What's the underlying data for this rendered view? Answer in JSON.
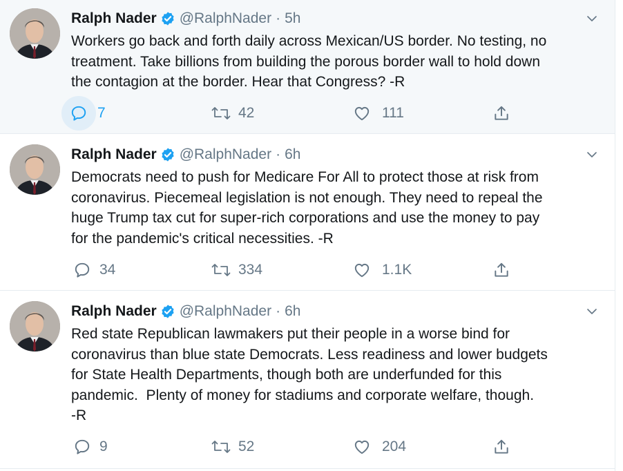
{
  "colors": {
    "accent": "#1da1f2",
    "muted": "#657786",
    "text": "#14171a",
    "border": "#e6ecf0",
    "hover_bg": "#f5f8fa"
  },
  "tweets": [
    {
      "name": "Ralph Nader",
      "handle": "@RalphNader",
      "time": "5h",
      "text": "Workers go back and forth daily across Mexican/US border. No testing, no\ntreatment. Take billions from building the porous border wall to hold down\nthe contagion at the border. Hear that Congress? -R",
      "replies": "7",
      "retweets": "42",
      "likes": "111",
      "icons": {
        "reply": "reply-icon",
        "retweet": "retweet-icon",
        "like": "heart-icon",
        "share": "share-icon",
        "menu": "chevron-down-icon",
        "verified": "verified-badge-icon"
      }
    },
    {
      "name": "Ralph Nader",
      "handle": "@RalphNader",
      "time": "6h",
      "text": "Democrats need to push for Medicare For All to protect those at risk from\ncoronavirus. Piecemeal legislation is not enough. They need to repeal the\nhuge Trump tax cut for super-rich corporations and use the money to pay\nfor the pandemic's critical necessities. -R",
      "replies": "34",
      "retweets": "334",
      "likes": "1.1K",
      "icons": {
        "reply": "reply-icon",
        "retweet": "retweet-icon",
        "like": "heart-icon",
        "share": "share-icon",
        "menu": "chevron-down-icon",
        "verified": "verified-badge-icon"
      }
    },
    {
      "name": "Ralph Nader",
      "handle": "@RalphNader",
      "time": "6h",
      "text": "Red state Republican lawmakers put their people in a worse bind for\ncoronavirus than blue state Democrats. Less readiness and lower budgets\nfor State Health Departments, though both are underfunded for this\npandemic.  Plenty of money for stadiums and corporate welfare, though.\n-R",
      "replies": "9",
      "retweets": "52",
      "likes": "204",
      "icons": {
        "reply": "reply-icon",
        "retweet": "retweet-icon",
        "like": "heart-icon",
        "share": "share-icon",
        "menu": "chevron-down-icon",
        "verified": "verified-badge-icon"
      }
    }
  ]
}
